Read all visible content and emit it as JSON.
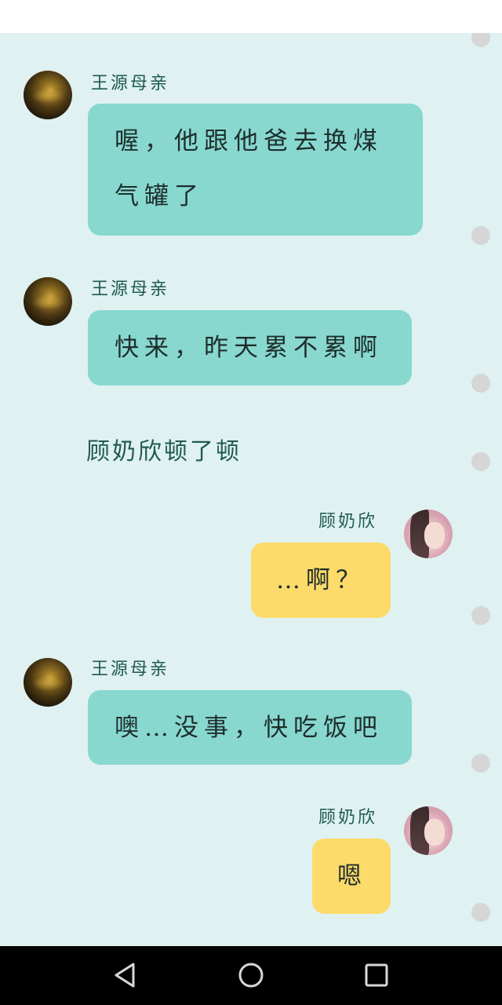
{
  "messages": [
    {
      "speaker": "王源母亲",
      "text_line1": "喔，他跟他爸去换煤",
      "text_line2": "气罐了"
    },
    {
      "speaker": "王源母亲",
      "text": "快来，昨天累不累啊"
    },
    {
      "narration": "顾奶欣顿了顿"
    },
    {
      "speaker": "顾奶欣",
      "text": "…啊？"
    },
    {
      "speaker": "王源母亲",
      "text": "噢…没事，快吃饭吧"
    },
    {
      "speaker": "顾奶欣",
      "text": "嗯"
    }
  ],
  "colors": {
    "chat_background": "#dff1f1",
    "mother_bubble": "#88d8d0",
    "self_bubble": "#fddb6b",
    "name_text": "#1f5b4e",
    "nav_bar": "#000000"
  },
  "icons": {
    "mother_avatar": "mother-avatar",
    "self_avatar": "girl-avatar",
    "nav_back": "triangle-back-icon",
    "nav_home": "circle-home-icon",
    "nav_recents": "square-recents-icon"
  }
}
